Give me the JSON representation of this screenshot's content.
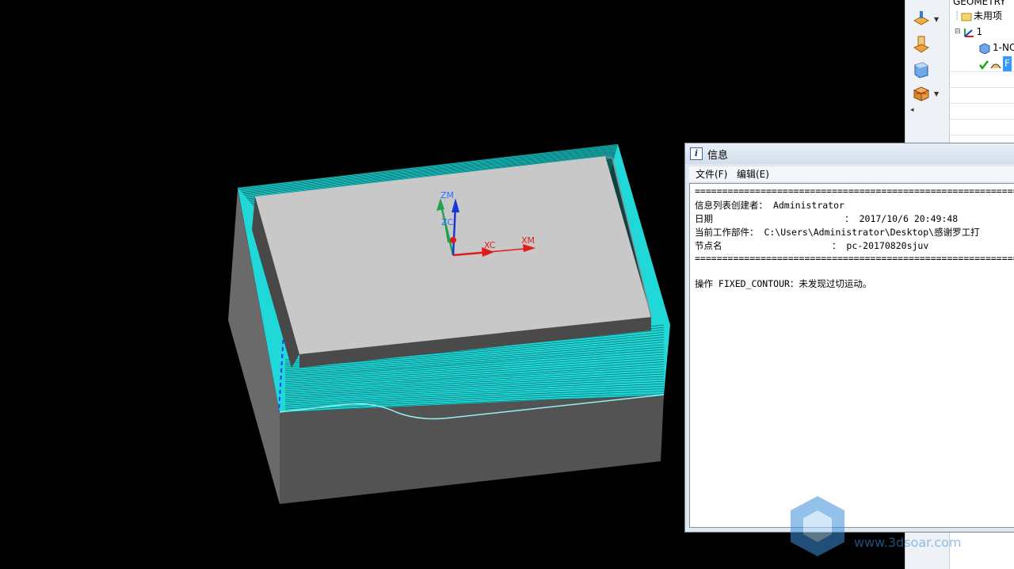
{
  "navigator": {
    "header": "GEOMETRY",
    "items": [
      {
        "label": "未用项"
      },
      {
        "label": "1"
      },
      {
        "label": "1-NC"
      },
      {
        "label": "F"
      }
    ]
  },
  "viewport": {
    "axes": {
      "zm": "ZM",
      "zc": "ZC",
      "xc": "XC",
      "xm": "XM"
    }
  },
  "info_window": {
    "title": "信息",
    "menu": [
      "文件(F)",
      "编辑(E)"
    ],
    "separator": "============================================================================",
    "lines": [
      {
        "label": "信息列表创建者：",
        "pad": " ",
        "value": "Administrator"
      },
      {
        "label": "日期",
        "pad": "                        ：",
        "value": " 2017/10/6 20:49:48"
      },
      {
        "label": "当前工作部件：",
        "pad": " ",
        "value": "C:\\Users\\Administrator\\Desktop\\感谢罗工打"
      },
      {
        "label": "节点名",
        "pad": "                    ：",
        "value": " pc-20170820sjuv"
      }
    ],
    "message": "操作 FIXED_CONTOUR：未发现过切运动。"
  },
  "watermark": {
    "text": "www.3dsoar.com"
  },
  "colors": {
    "toolpath": "#1ee8e8",
    "model_top": "#c8c8c8",
    "model_side": "#575757",
    "background": "#000000"
  }
}
